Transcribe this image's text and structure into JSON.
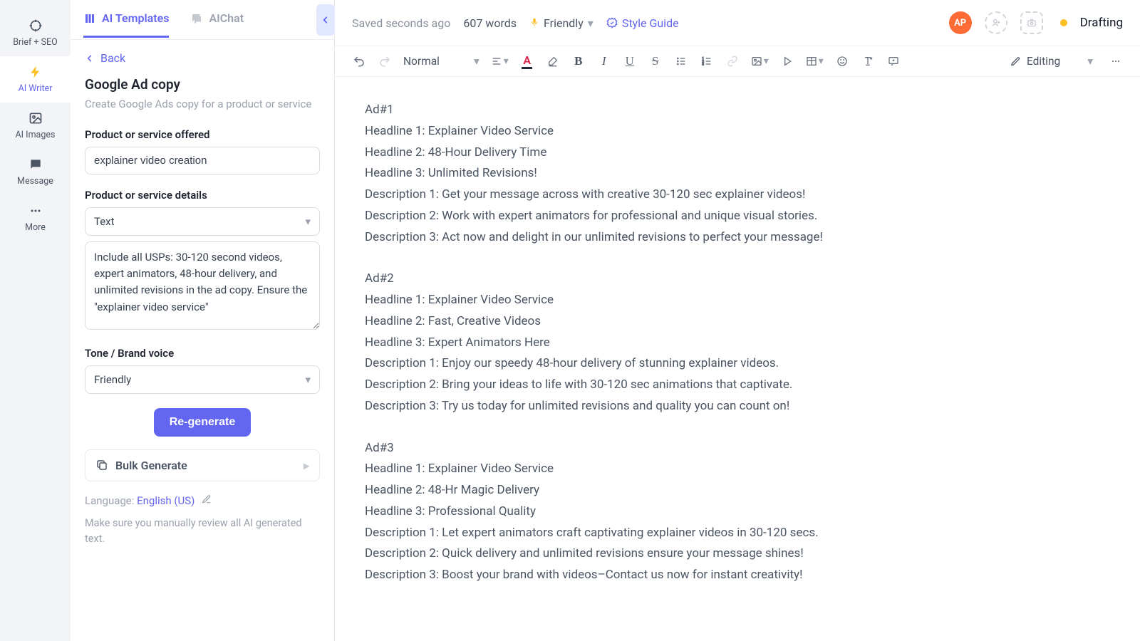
{
  "leftnav": {
    "brief": "Brief + SEO",
    "writer": "AI Writer",
    "images": "AI Images",
    "message": "Message",
    "more": "More"
  },
  "tabs": {
    "templates": "AI Templates",
    "chat": "AIChat"
  },
  "back": "Back",
  "panel": {
    "title": "Google Ad copy",
    "desc": "Create Google Ads copy for a product or service",
    "product_label": "Product or service offered",
    "product_value": "explainer video creation",
    "details_label": "Product or service details",
    "details_type": "Text",
    "details_value": "Include all USPs: 30-120 second videos, expert animators, 48-hour delivery, and unlimited revisions in the ad copy. Ensure the \"explainer video service\"",
    "tone_label": "Tone / Brand voice",
    "tone_value": "Friendly",
    "regen": "Re-generate",
    "bulk": "Bulk Generate",
    "lang_lbl": "Language: ",
    "lang_val": "English (US)",
    "disclaimer": "Make sure you manually review all AI generated text."
  },
  "top": {
    "saved": "Saved seconds ago",
    "words": "607 words",
    "tone": "Friendly",
    "styleguide": "Style Guide",
    "avatar": "AP",
    "status": "Drafting"
  },
  "toolbar": {
    "style": "Normal",
    "editing": "Editing"
  },
  "doc": [
    "Ad#1",
    "Headline 1: Explainer Video Service",
    "Headline 2: 48-Hour Delivery Time",
    "Headline 3: Unlimited Revisions!",
    "Description 1: Get your message across with creative 30-120 sec explainer videos!",
    "Description 2: Work with expert animators for professional and unique visual stories.",
    "Description 3: Act now and delight in our unlimited revisions to perfect your message!",
    "",
    "Ad#2",
    "Headline 1: Explainer Video Service",
    "Headline 2: Fast, Creative Videos",
    "Headline 3: Expert Animators Here",
    "Description 1: Enjoy our speedy 48-hour delivery of stunning explainer videos.",
    "Description 2: Bring your ideas to life with 30-120 sec animations that captivate.",
    "Description 3: Try us today for unlimited revisions and quality you can count on!",
    "",
    "Ad#3",
    "Headline 1: Explainer Video Service",
    "Headline 2: 48-Hr Magic Delivery",
    "Headline 3: Professional Quality",
    "Description 1: Let expert animators craft captivating explainer videos in 30-120 secs.",
    "Description 2: Quick delivery and unlimited revisions ensure your message shines!",
    "Description 3: Boost your brand with videos–Contact us now for instant creativity!"
  ]
}
